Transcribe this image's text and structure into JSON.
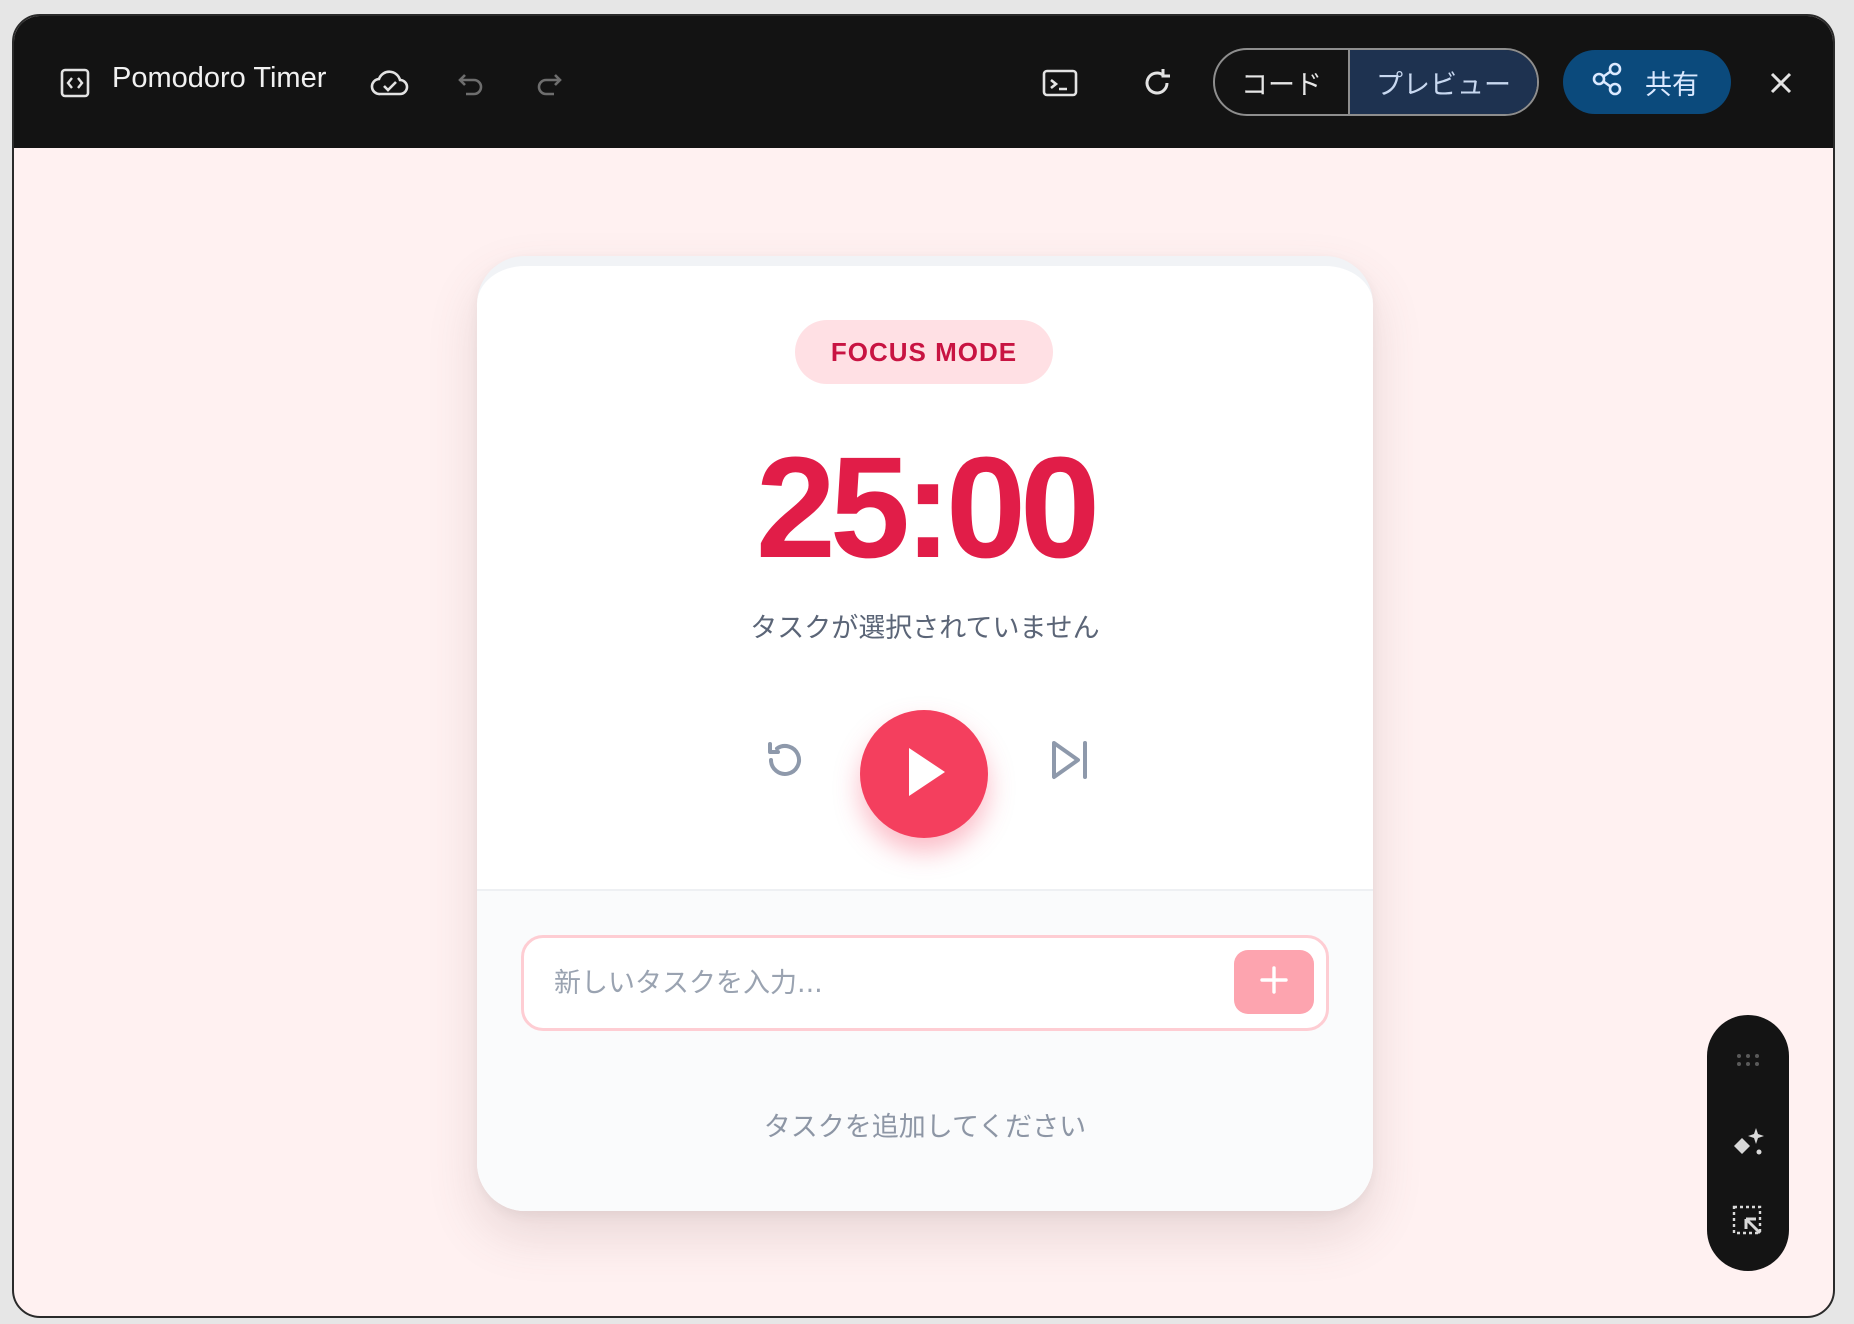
{
  "app": {
    "title": "Pomodoro Timer",
    "toggle": {
      "code_label": "コード",
      "preview_label": "プレビュー"
    },
    "share_label": "共有"
  },
  "timer_card": {
    "mode_badge": "FOCUS MODE",
    "time": "25:00",
    "task_status": "タスクが選択されていません",
    "task_input": {
      "placeholder": "新しいタスクを入力...",
      "value": ""
    },
    "empty_message": "タスクを追加してください"
  },
  "colors": {
    "accent": "#e11d48",
    "play_button": "#f43f5e",
    "badge_bg": "#ffe0e4",
    "page_bg": "#fff1f1",
    "share_button": "#0b4a7c"
  },
  "icons": {
    "topbar": [
      "code-window-icon",
      "cloud-check-icon",
      "undo-icon",
      "redo-icon",
      "terminal-icon",
      "refresh-icon",
      "share-icon",
      "close-icon"
    ],
    "controls": [
      "reset-icon",
      "play-icon",
      "skip-next-icon"
    ],
    "floating_toolbar": [
      "drag-handle-icon",
      "sparkle-icon",
      "select-area-icon"
    ]
  }
}
